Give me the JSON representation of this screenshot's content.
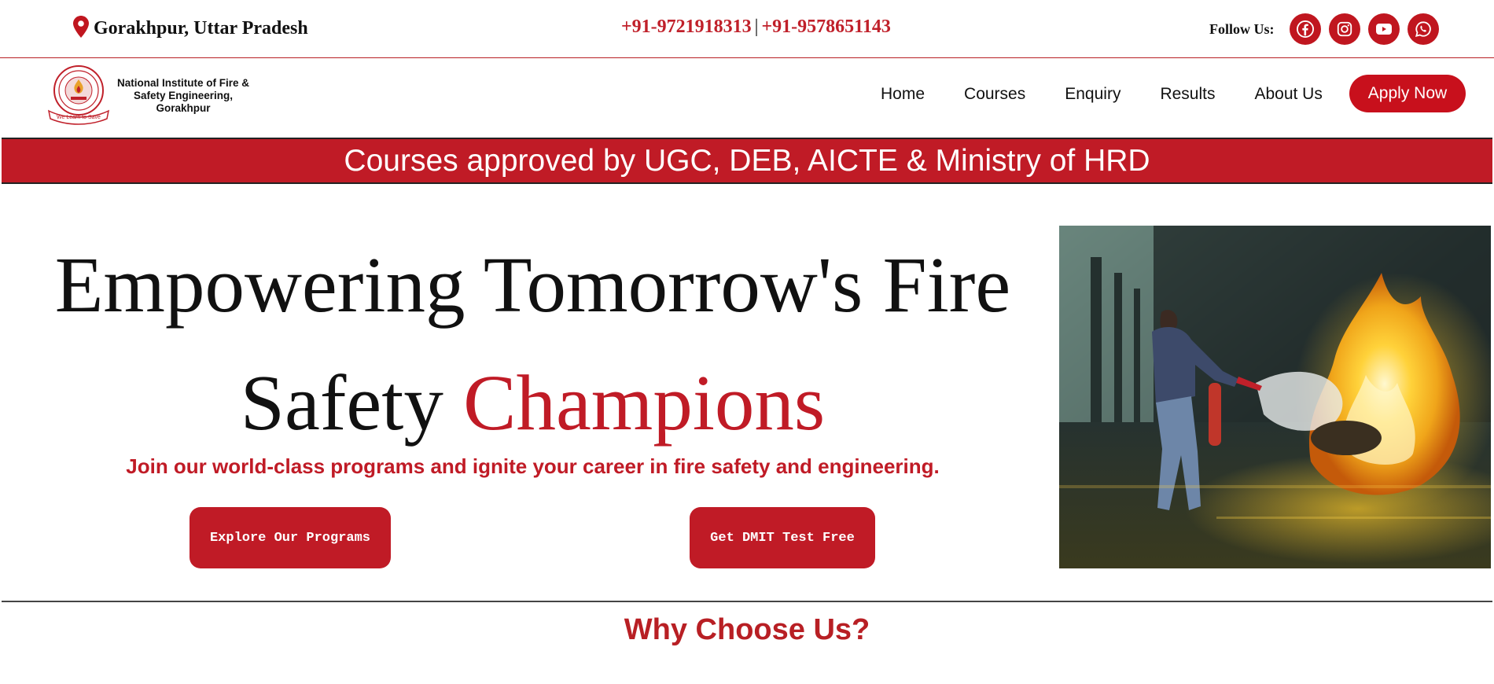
{
  "topbar": {
    "location": "Gorakhpur, Uttar Pradesh",
    "phone1": "+91-9721918313",
    "separator": "|",
    "phone2": "+91-9578651143",
    "follow_label": "Follow Us:",
    "social_icons": [
      "facebook-icon",
      "instagram-icon",
      "youtube-icon",
      "whatsapp-icon"
    ]
  },
  "header": {
    "logo_line1": "National Institute of Fire &",
    "logo_line2": "Safety Engineering,",
    "logo_line3": "Gorakhpur",
    "logo_ribbon": "We Learn to Save",
    "nav": [
      "Home",
      "Courses",
      "Enquiry",
      "Results",
      "About Us"
    ],
    "apply_label": "Apply Now"
  },
  "banner": {
    "text": "Courses approved by UGC, DEB, AICTE & Ministry of HRD"
  },
  "hero": {
    "title_line1": "Empowering Tomorrow's Fire",
    "title_line2_plain": "Safety ",
    "title_line2_accent": "Champions",
    "subtitle": "Join our world-class programs and ignite your career in fire safety and engineering.",
    "explore_label": "Explore Our Programs",
    "dmit_label": "Get DMIT Test Free"
  },
  "why": {
    "heading": "Why Choose Us?"
  },
  "colors": {
    "brand_red": "#c01b26",
    "apply_red": "#c8101c",
    "text_dark": "#111111"
  }
}
